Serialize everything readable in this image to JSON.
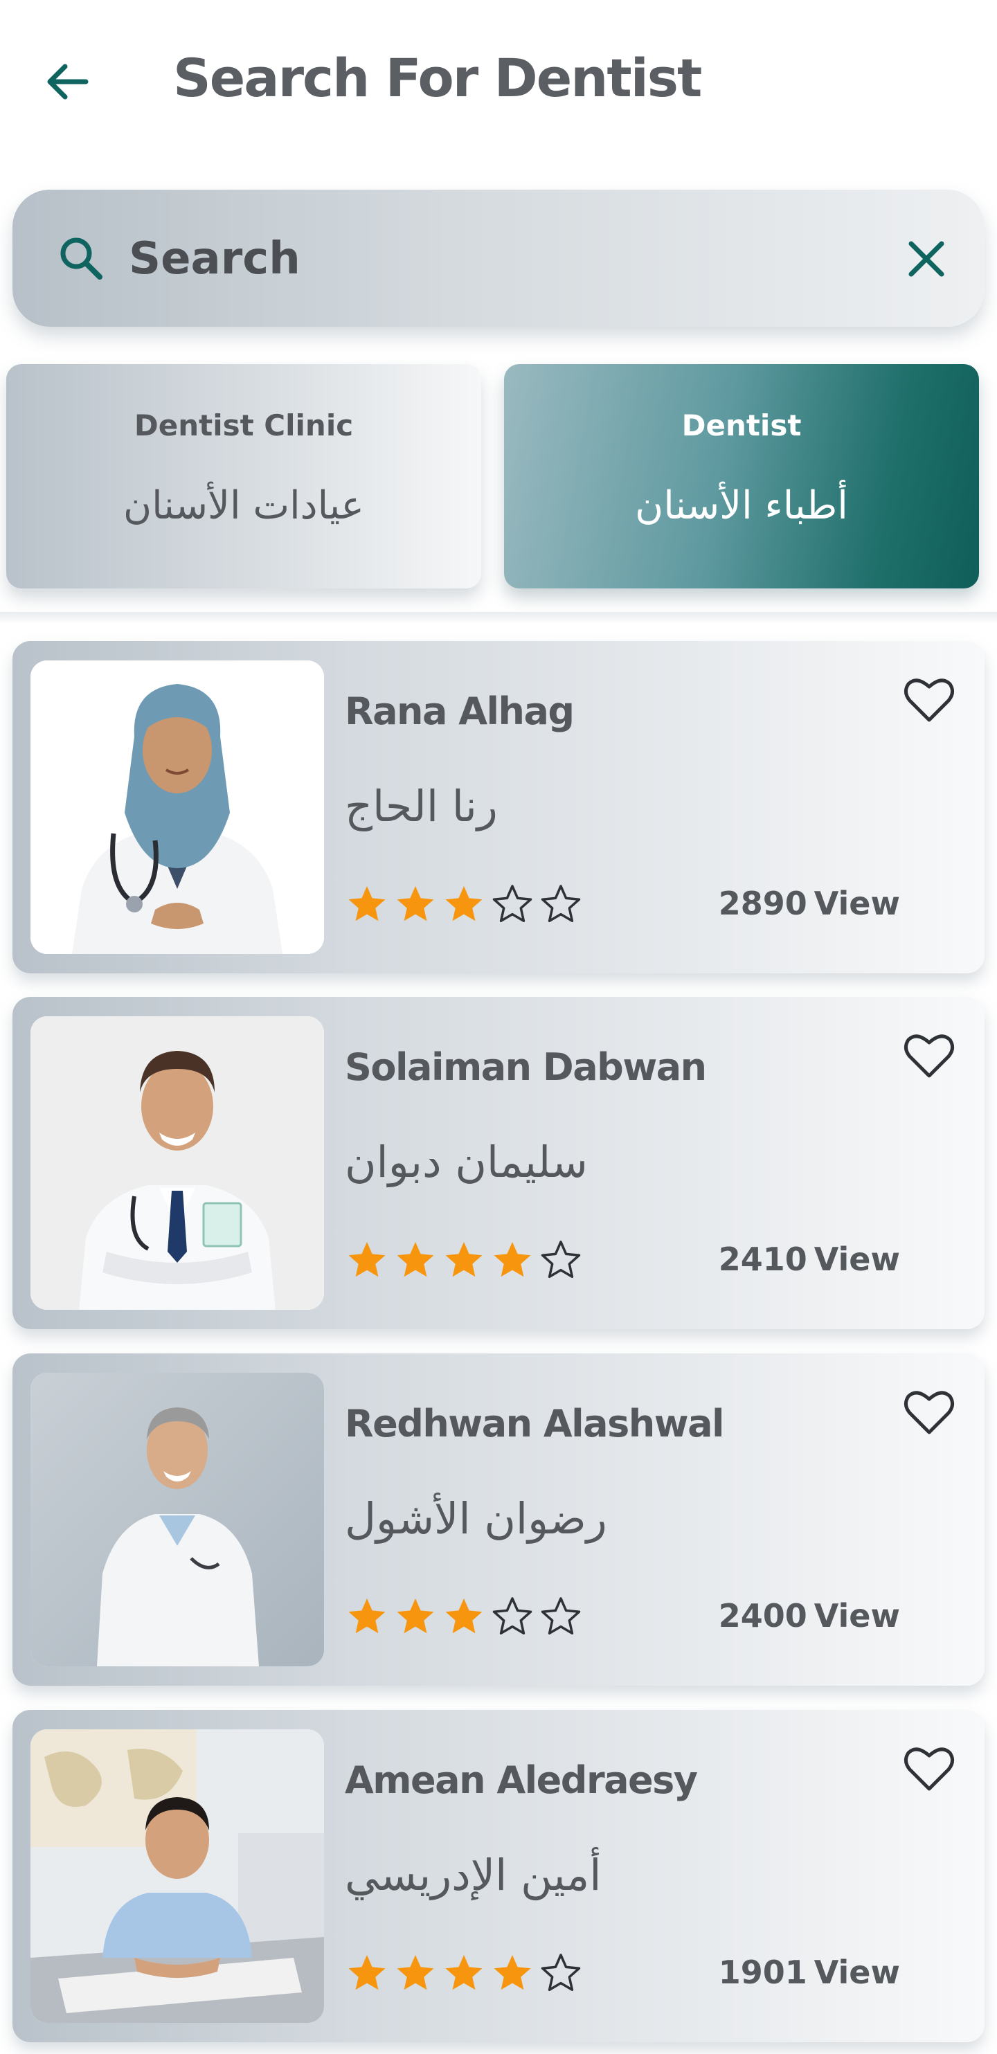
{
  "header": {
    "title": "Search For Dentist"
  },
  "search": {
    "placeholder": "Search",
    "value": ""
  },
  "tabs": {
    "clinic": {
      "en": "Dentist Clinic",
      "ar": "عيادات الأسنان",
      "selected": false
    },
    "dentist": {
      "en": "Dentist",
      "ar": "أطباء الأسنان",
      "selected": true
    }
  },
  "colors": {
    "accent": "#0f6460",
    "star_filled": "#f7960e",
    "text": "#55585d"
  },
  "icons": {
    "back": "arrow-left-icon",
    "search": "search-icon",
    "clear": "close-icon",
    "favorite": "heart-outline-icon",
    "star_full": "star-filled-icon",
    "star_empty": "star-outline-icon"
  },
  "dentists": [
    {
      "name_en": "Rana Alhag",
      "name_ar": "رنا الحاج",
      "rating": 3,
      "max_rating": 5,
      "views": "2890",
      "views_unit": "View"
    },
    {
      "name_en": "Solaiman Dabwan",
      "name_ar": "سليمان دبوان",
      "rating": 4,
      "max_rating": 5,
      "views": "2410",
      "views_unit": "View"
    },
    {
      "name_en": "Redhwan Alashwal",
      "name_ar": "رضوان الأشول",
      "rating": 3,
      "max_rating": 5,
      "views": "2400",
      "views_unit": "View"
    },
    {
      "name_en": "Amean Aledraesy",
      "name_ar": "أمين الإدريسي",
      "rating": 4,
      "max_rating": 5,
      "views": "1901",
      "views_unit": "View"
    }
  ]
}
